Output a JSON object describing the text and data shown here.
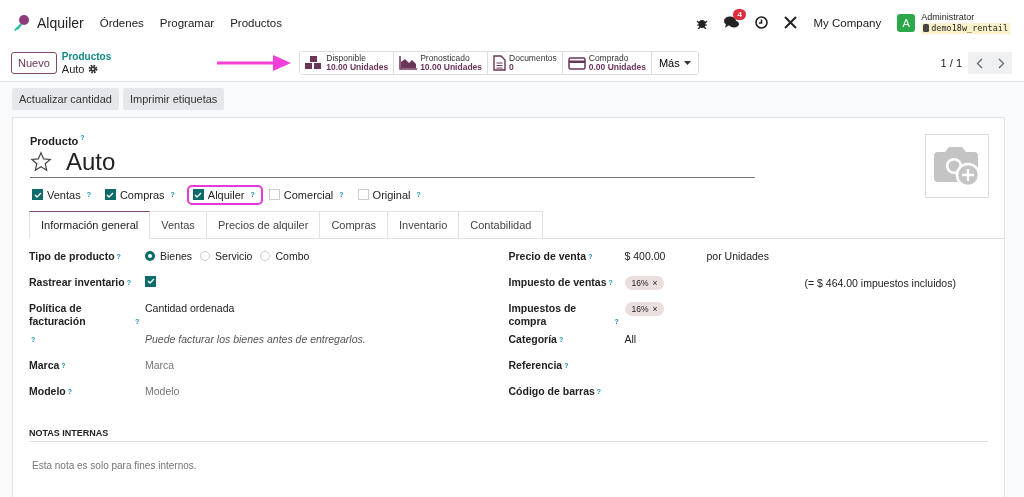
{
  "navbar": {
    "app": "Alquiler",
    "menu": [
      "Órdenes",
      "Programar",
      "Productos"
    ],
    "chat_count": "4",
    "company": "My Company",
    "user_initial": "A",
    "user": "Administrator",
    "database": "demo18w_rentail"
  },
  "control_panel": {
    "new_button": "Nuevo",
    "breadcrumb": "Productos",
    "record": "Auto",
    "more": "Más",
    "pager": "1 / 1",
    "smart_buttons": [
      {
        "kind": "stock",
        "label": "Disponible",
        "value": "10.00 Unidades"
      },
      {
        "kind": "forecast",
        "label": "Pronosticado",
        "value": "10.00 Unidades"
      },
      {
        "kind": "documents",
        "label": "Documentos",
        "value": "0"
      },
      {
        "kind": "purchased",
        "label": "Comprado",
        "value": "0.00 Unidades"
      }
    ]
  },
  "annotation_arrow": true,
  "actions": [
    "Actualizar cantidad",
    "Imprimir etiquetas"
  ],
  "form": {
    "name_label": "Producto",
    "name_help": "?",
    "name": "Auto",
    "favorite": false,
    "options": [
      {
        "label": "Ventas",
        "help": "?",
        "checked": true,
        "highlighted": false
      },
      {
        "label": "Compras",
        "help": "?",
        "checked": true,
        "highlighted": false
      },
      {
        "label": "Alquiler",
        "help": "?",
        "checked": true,
        "highlighted": true
      },
      {
        "label": "Comercial",
        "help": "?",
        "checked": false,
        "highlighted": false
      },
      {
        "label": "Original",
        "help": "?",
        "checked": false,
        "highlighted": false
      }
    ],
    "tabs": [
      {
        "label": "Información general",
        "selected": true
      },
      {
        "label": "Ventas",
        "selected": false
      },
      {
        "label": "Precios de alquiler",
        "selected": false
      },
      {
        "label": "Compras",
        "selected": false
      },
      {
        "label": "Inventario",
        "selected": false
      },
      {
        "label": "Contabilidad",
        "selected": false
      }
    ],
    "left_fields": [
      {
        "kind": "radio",
        "label": "Tipo de producto",
        "help": "?",
        "options": [
          {
            "label": "Bienes",
            "selected": true
          },
          {
            "label": "Servicio",
            "selected": false
          },
          {
            "label": "Combo",
            "selected": false
          }
        ]
      },
      {
        "kind": "checkbox",
        "label": "Rastrear inventario",
        "help": "?",
        "checked": true
      },
      {
        "kind": "text",
        "label": "Política de facturación",
        "help": "?",
        "value": "Cantidad ordenada"
      },
      {
        "kind": "note",
        "help": "?",
        "value": "Puede facturar los bienes antes de entregarlos."
      },
      {
        "kind": "input",
        "label": "Marca",
        "help": "?",
        "placeholder": "Marca"
      },
      {
        "kind": "input",
        "label": "Modelo",
        "help": "?",
        "placeholder": "Modelo"
      }
    ],
    "right_fields": [
      {
        "kind": "text",
        "label": "Precio de venta",
        "help": "?",
        "value": "$ 400.00",
        "suffix": "por Unidades"
      },
      {
        "kind": "tags",
        "label": "Impuesto de ventas",
        "help": "?",
        "tags": [
          {
            "label": "16%",
            "remove": "×"
          }
        ],
        "note": "(= $ 464.00 impuestos incluidos)"
      },
      {
        "kind": "tags",
        "label": "Impuestos de compra",
        "help": "?",
        "tags": [
          {
            "label": "16%",
            "remove": "×"
          }
        ]
      },
      {
        "kind": "text",
        "label": "Categoría",
        "help": "?",
        "value": "All"
      },
      {
        "kind": "empty",
        "label": "Referencia",
        "help": "?"
      },
      {
        "kind": "empty",
        "label": "Código de barras",
        "help": "?"
      }
    ],
    "notes": {
      "title": "NOTAS INTERNAS",
      "placeholder": "Esta nota es solo para fines internos."
    }
  }
}
